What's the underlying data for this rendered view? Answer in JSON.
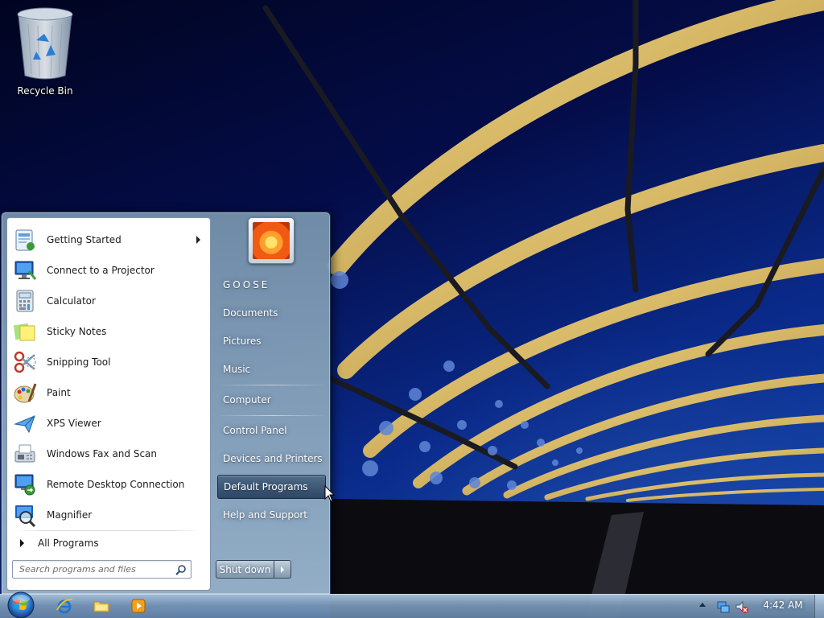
{
  "desktop": {
    "recycle_bin_label": "Recycle Bin"
  },
  "start_menu": {
    "programs": [
      {
        "label": "Getting Started",
        "icon": "getting-started-icon",
        "has_submenu": true
      },
      {
        "label": "Connect to a Projector",
        "icon": "projector-icon"
      },
      {
        "label": "Calculator",
        "icon": "calculator-icon"
      },
      {
        "label": "Sticky Notes",
        "icon": "sticky-notes-icon"
      },
      {
        "label": "Snipping Tool",
        "icon": "scissors-icon"
      },
      {
        "label": "Paint",
        "icon": "paint-palette-icon"
      },
      {
        "label": "XPS Viewer",
        "icon": "xps-viewer-icon"
      },
      {
        "label": "Windows Fax and Scan",
        "icon": "fax-icon"
      },
      {
        "label": "Remote Desktop Connection",
        "icon": "remote-desktop-icon"
      },
      {
        "label": "Magnifier",
        "icon": "magnifier-icon"
      }
    ],
    "all_programs_label": "All Programs",
    "search_placeholder": "Search programs and files",
    "user_name": "GOOSE",
    "right_items": [
      {
        "label": "Documents"
      },
      {
        "label": "Pictures"
      },
      {
        "label": "Music"
      },
      {
        "label": "Computer"
      },
      {
        "label": "Control Panel"
      },
      {
        "label": "Devices and Printers"
      },
      {
        "label": "Default Programs",
        "highlighted": true
      },
      {
        "label": "Help and Support"
      }
    ],
    "shutdown_label": "Shut down"
  },
  "taskbar": {
    "pinned_apps": [
      {
        "name": "Internet Explorer",
        "icon": "internet-explorer-icon"
      },
      {
        "name": "Windows Explorer",
        "icon": "folder-icon"
      },
      {
        "name": "Windows Media Player",
        "icon": "media-player-icon"
      }
    ],
    "tray_icons": [
      "network-icon",
      "speaker-muted-icon"
    ],
    "clock": "4:42 AM"
  },
  "colors": {
    "wallpaper_sky": "#0a2a8a",
    "menu_glass": "#9ab4c8",
    "highlight": "#3c5a7a"
  }
}
